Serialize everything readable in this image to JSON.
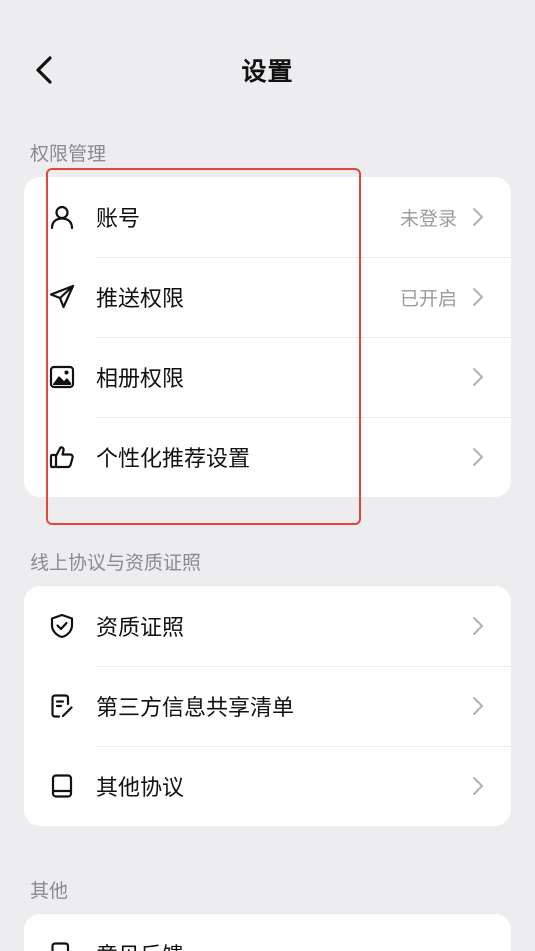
{
  "header": {
    "title": "设置",
    "back_icon": "chevron-left-icon"
  },
  "sections": [
    {
      "label": "权限管理",
      "items": [
        {
          "label": "账号",
          "status": "未登录",
          "icon": "user-icon"
        },
        {
          "label": "推送权限",
          "status": "已开启",
          "icon": "send-icon"
        },
        {
          "label": "相册权限",
          "status": "",
          "icon": "image-icon"
        },
        {
          "label": "个性化推荐设置",
          "status": "",
          "icon": "thumbs-up-icon"
        }
      ]
    },
    {
      "label": "线上协议与资质证照",
      "items": [
        {
          "label": "资质证照",
          "status": "",
          "icon": "shield-check-icon"
        },
        {
          "label": "第三方信息共享清单",
          "status": "",
          "icon": "document-edit-icon"
        },
        {
          "label": "其他协议",
          "status": "",
          "icon": "book-icon"
        }
      ]
    },
    {
      "label": "其他",
      "items": [
        {
          "label": "意见反馈",
          "status": "",
          "icon": "feedback-icon"
        }
      ]
    }
  ],
  "colors": {
    "background": "#ededf0",
    "card": "#ffffff",
    "highlight": "#e0473d",
    "secondary_text": "#9a9aa0"
  }
}
